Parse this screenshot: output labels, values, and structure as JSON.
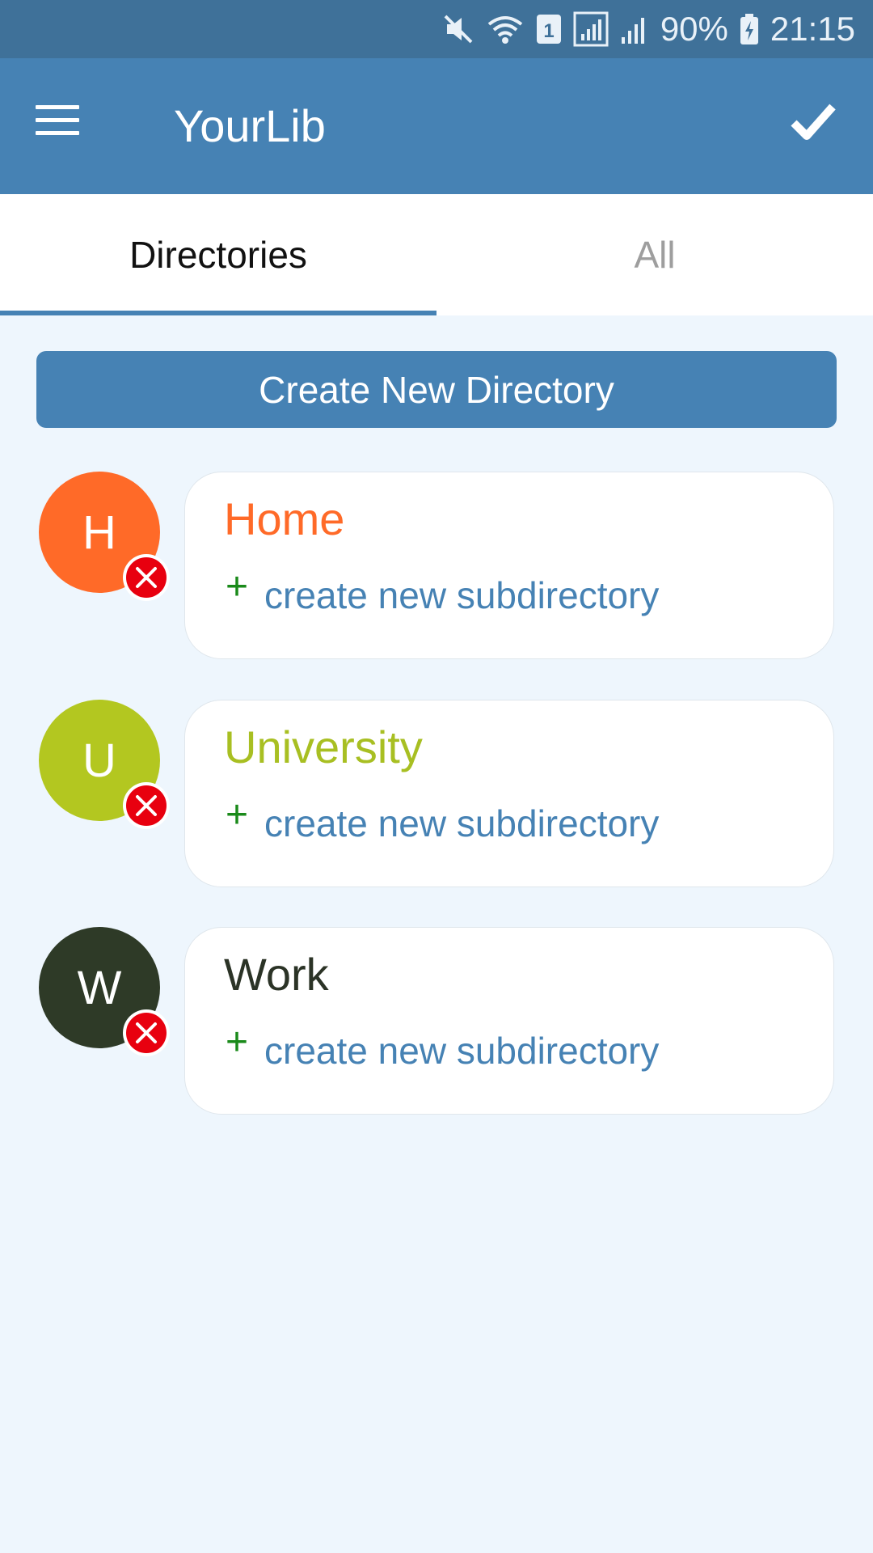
{
  "status_bar": {
    "battery": "90%",
    "time": "21:15",
    "sim_slot": "1",
    "icons": [
      "mute-icon",
      "wifi-icon",
      "sim-1-icon",
      "signal-icon",
      "signal-icon",
      "battery-charging-icon"
    ]
  },
  "app_bar": {
    "title": "YourLib",
    "menu_icon": "menu-icon",
    "confirm_icon": "check-icon"
  },
  "tabs": [
    {
      "label": "Directories",
      "active": true
    },
    {
      "label": "All",
      "active": false
    }
  ],
  "create_button": {
    "label": "Create New Directory"
  },
  "directories": [
    {
      "initial": "H",
      "name": "Home",
      "color": "#ff6a28",
      "title_color": "#ff6a28",
      "subdirectory_label": "create new subdirectory"
    },
    {
      "initial": "U",
      "name": "University",
      "color": "#b3c720",
      "title_color": "#a8bf22",
      "subdirectory_label": "create new subdirectory"
    },
    {
      "initial": "W",
      "name": "Work",
      "color": "#2e3a27",
      "title_color": "#2b3326",
      "subdirectory_label": "create new subdirectory"
    }
  ],
  "colors": {
    "primary": "#4682b4",
    "status_bar": "#3f7199",
    "background": "#eef6fd",
    "remove": "#e8000f",
    "plus": "#1a8a1a"
  }
}
